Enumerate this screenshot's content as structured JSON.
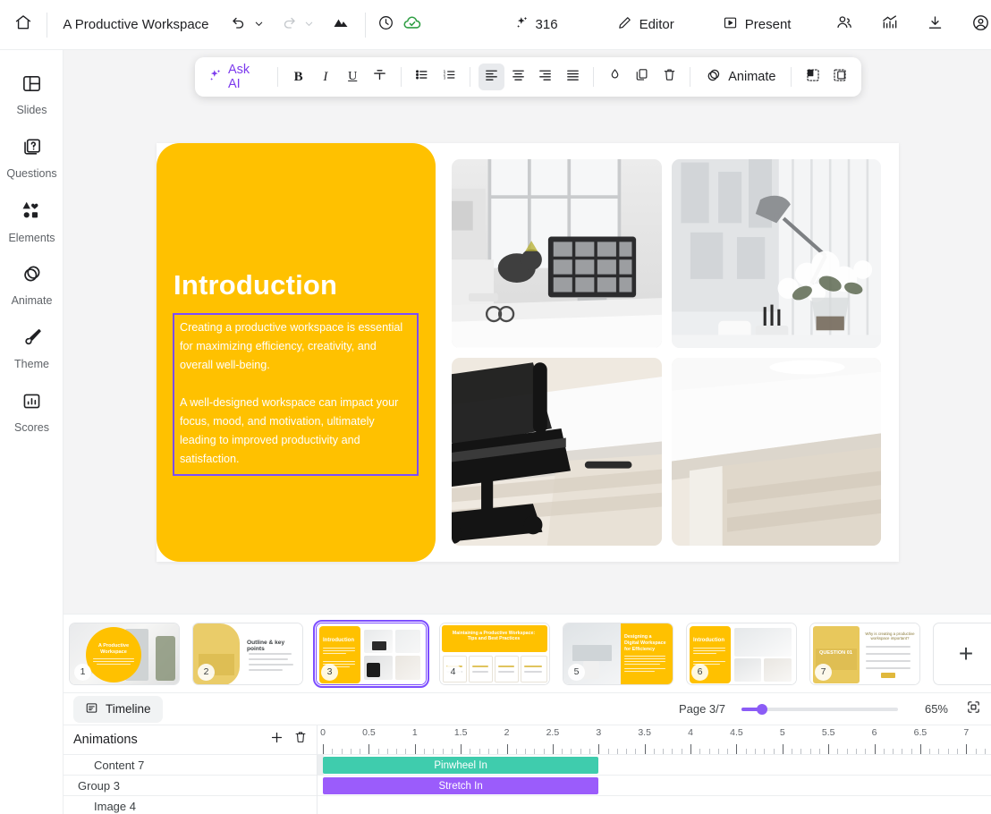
{
  "topbar": {
    "home_icon": "home-icon",
    "doc_title": "A Productive Workspace",
    "undo_icon": "undo-icon",
    "undo_caret_icon": "chevron-down-icon",
    "redo_icon": "redo-icon",
    "redo_caret_icon": "chevron-down-icon",
    "image_icon": "image-mountain-icon",
    "history_icon": "clock-history-icon",
    "cloud_saved_icon": "cloud-check-icon",
    "cloud_saved_color": "#2e9e43",
    "credits_icon": "sparkle-ai-icon",
    "credits_value": "316",
    "editor_icon": "pencil-icon",
    "editor_label": "Editor",
    "present_icon": "play-rect-icon",
    "present_label": "Present",
    "share_icon": "people-share-icon",
    "analytics_icon": "analytics-chart-icon",
    "download_icon": "download-icon",
    "account_icon": "account-circle-icon"
  },
  "rail": {
    "items": [
      {
        "label": "Slides",
        "icon": "layout-slides-icon"
      },
      {
        "label": "Questions",
        "icon": "question-card-icon"
      },
      {
        "label": "Elements",
        "icon": "shapes-icon"
      },
      {
        "label": "Animate",
        "icon": "layers-animate-icon"
      },
      {
        "label": "Theme",
        "icon": "paintbrush-icon"
      },
      {
        "label": "Scores",
        "icon": "bar-chart-icon"
      }
    ]
  },
  "format_toolbar": {
    "ask_ai_label": "Ask AI",
    "ask_ai_icon": "sparkle-ai-icon",
    "ask_ai_color": "#7c3aed",
    "bold_label": "B",
    "italic_label": "I",
    "underline_label": "U",
    "strikethrough_icon": "strikethrough-icon",
    "bullet_list_icon": "bullet-list-icon",
    "numbered_list_icon": "numbered-list-icon",
    "align_left_icon": "align-left-icon",
    "align_center_icon": "align-center-icon",
    "align_right_icon": "align-right-icon",
    "align_justify_icon": "align-justify-icon",
    "color_icon": "color-droplet-icon",
    "duplicate_icon": "duplicate-icon",
    "delete_icon": "trash-icon",
    "animate_icon": "layers-animate-icon",
    "animate_label": "Animate",
    "position_icon": "position-front-icon",
    "layer_icon": "layer-back-icon",
    "active_button": "align-left-icon"
  },
  "slide": {
    "accent_color": "#FFC100",
    "selection_color": "#7c4dff",
    "title": "Introduction",
    "paragraphs": [
      "Creating a productive workspace is essential for maximizing efficiency, creativity, and overall well-being.",
      "A well-designed workspace can impact your focus, mood, and motivation, ultimately leading to improved productivity and satisfaction."
    ],
    "images": [
      {
        "name": "desk-with-imac-monitor"
      },
      {
        "name": "desk-lamp-and-flowers"
      },
      {
        "name": "black-office-chair"
      },
      {
        "name": "white-desk-corner"
      }
    ]
  },
  "thumbnails": [
    {
      "number": "1",
      "title": "A Productive Workspace",
      "subtitle": "Unlock your creative with a workspace designed to enhance focus and productivity",
      "layout": "title-circle"
    },
    {
      "number": "2",
      "title": "Outline & key points",
      "layout": "outline"
    },
    {
      "number": "3",
      "title": "Introduction",
      "layout": "intro",
      "selected": true
    },
    {
      "number": "4",
      "title": "Maintaining a Productive Workspace: Tips and Best Practices",
      "layout": "cards"
    },
    {
      "number": "5",
      "title": "Designing a Digital Workspace for Efficiency",
      "layout": "photo-text"
    },
    {
      "number": "6",
      "title": "Introduction",
      "layout": "intro"
    },
    {
      "number": "7",
      "title": "QUESTION 01",
      "subtitle": "Why is creating a productive workspace important?",
      "layout": "quiz"
    }
  ],
  "add_slide_label": "+",
  "bottombar": {
    "timeline_icon": "timeline-icon",
    "timeline_label": "Timeline",
    "page_label": "Page 3/7",
    "zoom_value": "65%",
    "fit_icon": "fit-screen-icon"
  },
  "animations": {
    "panel_title": "Animations",
    "add_icon": "plus-icon",
    "delete_icon": "trash-icon",
    "ruler": {
      "max": 7.25,
      "major_ticks": [
        "0",
        "0.5",
        "1",
        "1.5",
        "2",
        "2.5",
        "3",
        "3.5",
        "4",
        "4.5",
        "5",
        "5.5",
        "6",
        "6.5",
        "7"
      ]
    },
    "rows": [
      {
        "label": "Content 7",
        "indent": 2,
        "effect": "Pinwheel In",
        "start": 0,
        "end": 3,
        "color": "#3FCCAD"
      },
      {
        "label": "Group 3",
        "indent": 1,
        "effect": "Stretch In",
        "start": 0,
        "end": 3,
        "color": "#9B5CFB"
      },
      {
        "label": "Image 4",
        "indent": 2,
        "effect": "",
        "start": 0,
        "end": 0,
        "color": ""
      }
    ]
  }
}
